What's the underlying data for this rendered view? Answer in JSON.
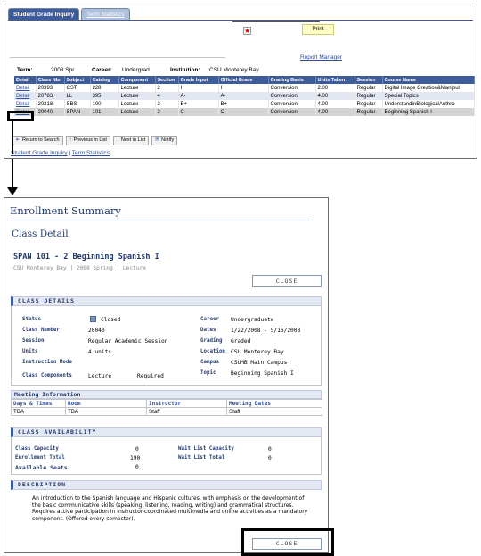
{
  "tabs": {
    "active": "Student Grade Inquiry",
    "inactive": "Term Statistics"
  },
  "toolbar": {
    "print_label": "Print",
    "report_manager": "Report Manager"
  },
  "term_line": {
    "term_label": "Term:",
    "term_value": "2008 Spr",
    "career_label": "Career:",
    "career_value": "Undergrad",
    "institution_label": "Institution:",
    "institution_value": "CSU Monterey Bay"
  },
  "grades": {
    "columns": [
      "Detail",
      "Class Nbr",
      "Subject",
      "Catalog",
      "Component",
      "Section",
      "Grade Input",
      "Official Grade",
      "Grading Basis",
      "Units Taken",
      "Session",
      "Course Name"
    ],
    "rows": [
      [
        "Detail",
        "20393",
        "CST",
        "228",
        "Lecture",
        "2",
        "I",
        "I",
        "Conversion",
        "2.00",
        "Regular",
        "Digital Image Creation&Manipul"
      ],
      [
        "Detail",
        "20783",
        "LL",
        "395",
        "Lecture",
        "4",
        "A-",
        "A-",
        "Conversion",
        "4.00",
        "Regular",
        "Special Topics"
      ],
      [
        "Detail",
        "20218",
        "SBS",
        "100",
        "Lecture",
        "2",
        "B+",
        "B+",
        "Conversion",
        "4.00",
        "Regular",
        "UnderstandinBiologicalAnthro"
      ],
      [
        "Detail",
        "20040",
        "SPAN",
        "101",
        "Lecture",
        "2",
        "C",
        "C",
        "Conversion",
        "4.00",
        "Regular",
        "Beginning Spanish I"
      ]
    ]
  },
  "nav_buttons": {
    "return": "Return to Search",
    "previous": "Previous in List",
    "next": "Next in List",
    "notify": "Notify"
  },
  "footer_links": {
    "link1": "Student Grade Inquiry",
    "separator": " | ",
    "link2": "Term Statistics"
  },
  "detail": {
    "summary_title": "Enrollment Summary",
    "page_title": "Class Detail",
    "course_heading": "SPAN  101 - 2   Beginning Spanish I",
    "course_sub": "CSU Monterey Bay | 2008 Spring | Lecture",
    "close_label": "CLOSE",
    "class_details_title": "CLASS DETAILS",
    "class_details": {
      "status_label": "Status",
      "status_value": "Closed",
      "class_number_label": "Class Number",
      "class_number_value": "20040",
      "session_label": "Session",
      "session_value": "Regular Academic Session",
      "units_label": "Units",
      "units_value": "4 units",
      "instruction_mode_label": "Instruction Mode",
      "instruction_mode_value": "",
      "class_components_label": "Class Components",
      "component_value": "Lecture",
      "component_required": "Required",
      "career_label": "Career",
      "career_value": "Undergraduate",
      "dates_label": "Dates",
      "dates_value": "1/22/2008 - 5/16/2008",
      "grading_label": "Grading",
      "grading_value": "Graded",
      "location_label": "Location",
      "location_value": "CSU Monterey Bay",
      "campus_label": "Campus",
      "campus_value": "CSUMB Main Campus",
      "topic_label": "Topic",
      "topic_value": "Beginning Spanish I"
    },
    "meeting_title": "Meeting Information",
    "meeting_columns": [
      "Days & Times",
      "Room",
      "Instructor",
      "Meeting Dates"
    ],
    "meeting_rows": [
      [
        "TBA",
        "TBA",
        "Staff",
        "Staff"
      ]
    ],
    "availability_title": "CLASS AVAILABILITY",
    "availability": {
      "capacity_label": "Class Capacity",
      "capacity_value": "0",
      "enroll_total_label": "Enrollment Total",
      "enroll_total_value": "190",
      "available_label": "Available Seats",
      "available_value": "0",
      "wait_capacity_label": "Wait List Capacity",
      "wait_capacity_value": "0",
      "wait_total_label": "Wait List Total",
      "wait_total_value": "0"
    },
    "description_title": "DESCRIPTION",
    "description": "An introduction to the Spanish language and Hispanic cultures, with emphasis on the development of the basic communicative skills (speaking, listening, reading, writing) and grammatical structures. Requires active participation in instructor-coordinated multimedia and online activities as a mandatory component. (Offered every semester)."
  }
}
